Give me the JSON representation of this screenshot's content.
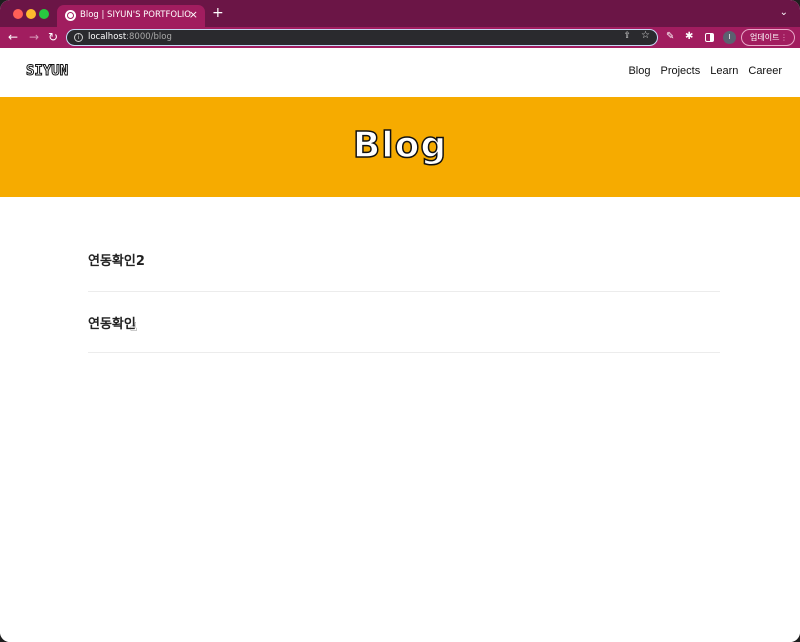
{
  "browser": {
    "tab_title": "Blog | SIYUN'S PORTFOLIO",
    "tab_close": "×",
    "new_tab": "+",
    "tab_menu": "⌄",
    "nav_back": "←",
    "nav_forward": "→",
    "nav_reload": "↻",
    "url_host": "localhost",
    "url_rest": ":8000/blog",
    "share_icon": "⇪",
    "star_icon": "☆",
    "profile_initial": "I",
    "update_label": "업데이트",
    "update_menu": "⋮",
    "colors": {
      "tabbar": "#6b1546",
      "toolbar": "#a11d5f"
    }
  },
  "site": {
    "logo": "SIYUN",
    "nav": [
      "Blog",
      "Projects",
      "Learn",
      "Career"
    ],
    "hero_title": "Blog",
    "hero_color": "#f6ab00"
  },
  "posts": [
    {
      "title": "연동확인2"
    },
    {
      "title": "연동확인"
    }
  ]
}
